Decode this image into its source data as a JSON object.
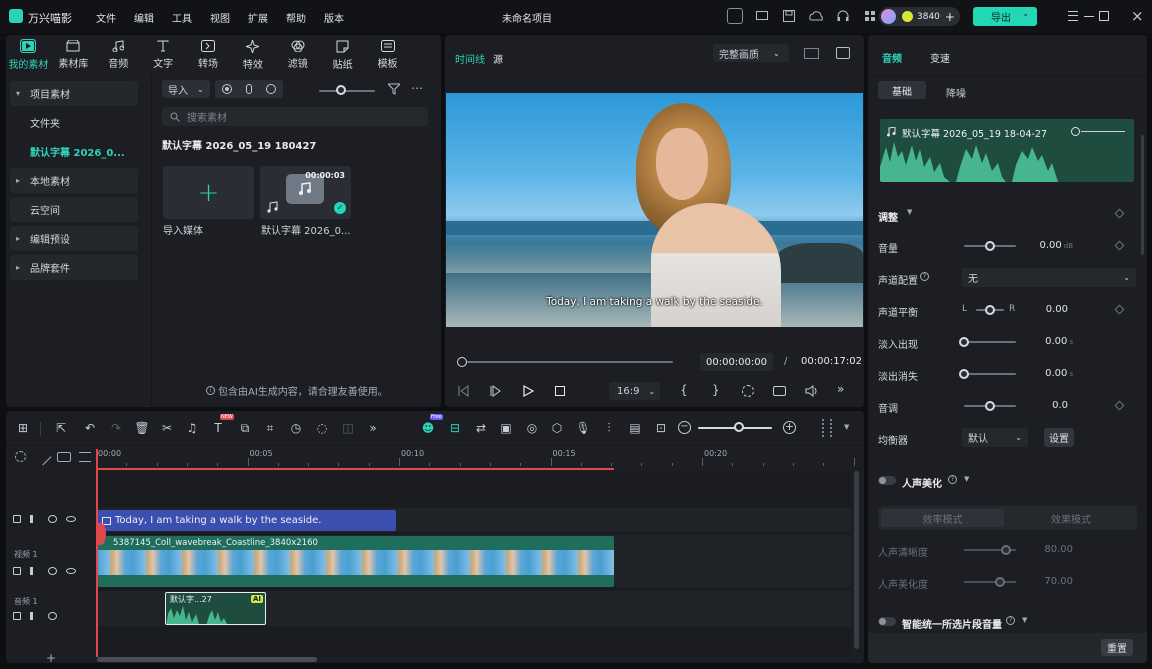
{
  "app": {
    "name": "万兴喵影",
    "title": "未命名项目",
    "credits": "3840",
    "export_label": "导出"
  },
  "menu": [
    "文件",
    "编辑",
    "工具",
    "视图",
    "扩展",
    "帮助",
    "版本"
  ],
  "media_tabs": [
    {
      "label": "我的素材",
      "icon": "media-icon"
    },
    {
      "label": "素材库",
      "icon": "library-icon"
    },
    {
      "label": "音频",
      "icon": "music-icon"
    },
    {
      "label": "文字",
      "icon": "text-icon"
    },
    {
      "label": "转场",
      "icon": "transition-icon"
    },
    {
      "label": "特效",
      "icon": "effects-icon"
    },
    {
      "label": "滤镜",
      "icon": "filter-icon"
    },
    {
      "label": "贴纸",
      "icon": "sticker-icon"
    },
    {
      "label": "模板",
      "icon": "template-icon"
    }
  ],
  "sidebar": {
    "items": [
      {
        "label": "项目素材",
        "type": "group",
        "open": true
      },
      {
        "label": "文件夹",
        "type": "child"
      },
      {
        "label": "默认字幕 2026_0...",
        "type": "child-active"
      },
      {
        "label": "本地素材",
        "type": "group"
      },
      {
        "label": "云空间",
        "type": "plain"
      },
      {
        "label": "编辑预设",
        "type": "group"
      },
      {
        "label": "品牌套件",
        "type": "group"
      }
    ]
  },
  "media": {
    "import_label": "导入",
    "search_placeholder": "搜索素材",
    "folder_title": "默认字幕 2026_05_19 180427",
    "tiles": [
      {
        "label": "导入媒体"
      },
      {
        "label": "默认字幕 2026_0...",
        "duration": "00:00:03"
      }
    ],
    "ai_note": "包含由AI生成内容，请合理友善使用。"
  },
  "preview": {
    "tabs": [
      "时间线",
      "源"
    ],
    "quality": "完整画质",
    "subtitle": "Today, I am taking a walk by the seaside.",
    "current_time": "00:00:00:00",
    "separator": "/",
    "total_time": "00:00:17:02",
    "aspect": "16:9",
    "progress": 0
  },
  "props": {
    "tabs": [
      "音频",
      "变速"
    ],
    "subtabs": [
      "基础",
      "降噪"
    ],
    "clip_name": "默认字幕 2026_05_19 18-04-27",
    "adjust_label": "调整",
    "rows": [
      {
        "label": "音量",
        "value": "0.00",
        "unit": "dB",
        "pos": 0.5
      },
      {
        "label": "声道配置",
        "select": "无"
      },
      {
        "label": "声道平衡",
        "value": "0.00",
        "left": "L",
        "right": "R",
        "pos": 0.5
      },
      {
        "label": "淡入出现",
        "value": "0.00",
        "unit": "s",
        "pos": 0
      },
      {
        "label": "淡出消失",
        "value": "0.00",
        "unit": "s",
        "pos": 0
      },
      {
        "label": "音调",
        "value": "0.0",
        "pos": 0.5
      },
      {
        "label": "均衡器",
        "select": "默认",
        "button": "设置"
      }
    ],
    "voice_label": "人声美化",
    "voice_modes": [
      "效率模式",
      "效果模式"
    ],
    "voice_rows": [
      {
        "label": "人声清晰度",
        "value": "80.00",
        "pos": 0.8
      },
      {
        "label": "人声美化度",
        "value": "70.00",
        "pos": 0.7
      }
    ],
    "smart_label": "智能统一所选片段音量",
    "reset_label": "重置"
  },
  "timeline": {
    "ruler": [
      "00:00",
      "00:05",
      "00:10",
      "00:15",
      "00:20"
    ],
    "subtitle_clip": "Today, I am taking a walk by the seaside.",
    "video_track": "视频 1",
    "video_clip": "5387145_Coll_wavebreak_Coastline_3840x2160",
    "audio_track": "音频 1",
    "audio_clip": "默认字...27",
    "badge_ai": "AI",
    "badge_new": "NEW",
    "badge_free": "Free"
  }
}
